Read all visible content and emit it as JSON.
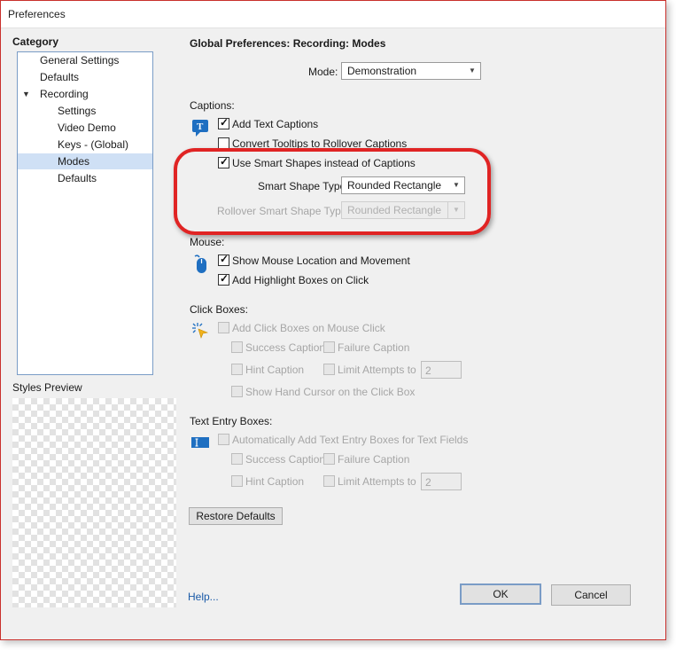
{
  "window": {
    "title": "Preferences"
  },
  "sidebar": {
    "category_label": "Category",
    "items": [
      {
        "label": "General Settings"
      },
      {
        "label": "Defaults"
      },
      {
        "label": "Recording"
      },
      {
        "label": "Settings"
      },
      {
        "label": "Video Demo"
      },
      {
        "label": "Keys - (Global)"
      },
      {
        "label": "Modes",
        "selected": true
      },
      {
        "label": "Defaults"
      }
    ],
    "styles_preview_label": "Styles Preview"
  },
  "main": {
    "title": "Global Preferences: Recording: Modes",
    "mode": {
      "label": "Mode:",
      "value": "Demonstration"
    },
    "captions": {
      "heading": "Captions:",
      "icon": "text-caption-icon",
      "add_text_captions": {
        "label": "Add Text Captions",
        "checked": true
      },
      "convert_tooltips": {
        "label": "Convert Tooltips to Rollover Captions",
        "checked": false
      },
      "use_smart_shapes": {
        "label": "Use Smart Shapes instead of Captions",
        "checked": true
      },
      "smart_shape_type": {
        "label": "Smart Shape Type",
        "value": "Rounded Rectangle"
      },
      "rollover_smart_shape_type": {
        "label": "Rollover Smart Shape Type",
        "value": "Rounded Rectangle",
        "enabled": false
      }
    },
    "mouse": {
      "heading": "Mouse:",
      "icon": "mouse-icon",
      "show_location": {
        "label": "Show Mouse Location and Movement",
        "checked": true
      },
      "highlight_boxes": {
        "label": "Add Highlight Boxes on Click",
        "checked": true
      }
    },
    "click_boxes": {
      "heading": "Click Boxes:",
      "icon": "click-box-icon",
      "add_click_boxes": {
        "label": "Add Click Boxes on Mouse Click"
      },
      "success_caption": {
        "label": "Success Caption"
      },
      "failure_caption": {
        "label": "Failure Caption"
      },
      "hint_caption": {
        "label": "Hint Caption"
      },
      "limit_attempts": {
        "label": "Limit Attempts to",
        "value": "2"
      },
      "show_hand_cursor": {
        "label": "Show Hand Cursor on the Click Box"
      }
    },
    "text_entry_boxes": {
      "heading": "Text Entry Boxes:",
      "icon": "text-entry-icon",
      "auto_add": {
        "label": "Automatically Add Text Entry Boxes for Text Fields"
      },
      "success_caption": {
        "label": "Success Caption"
      },
      "failure_caption": {
        "label": "Failure Caption"
      },
      "hint_caption": {
        "label": "Hint Caption"
      },
      "limit_attempts": {
        "label": "Limit Attempts to",
        "value": "2"
      }
    },
    "restore_defaults": "Restore Defaults"
  },
  "footer": {
    "help": "Help...",
    "ok": "OK",
    "cancel": "Cancel"
  },
  "colors": {
    "highlight": "#e02424",
    "selection": "#cfe0f5",
    "link": "#1a5aa8"
  }
}
